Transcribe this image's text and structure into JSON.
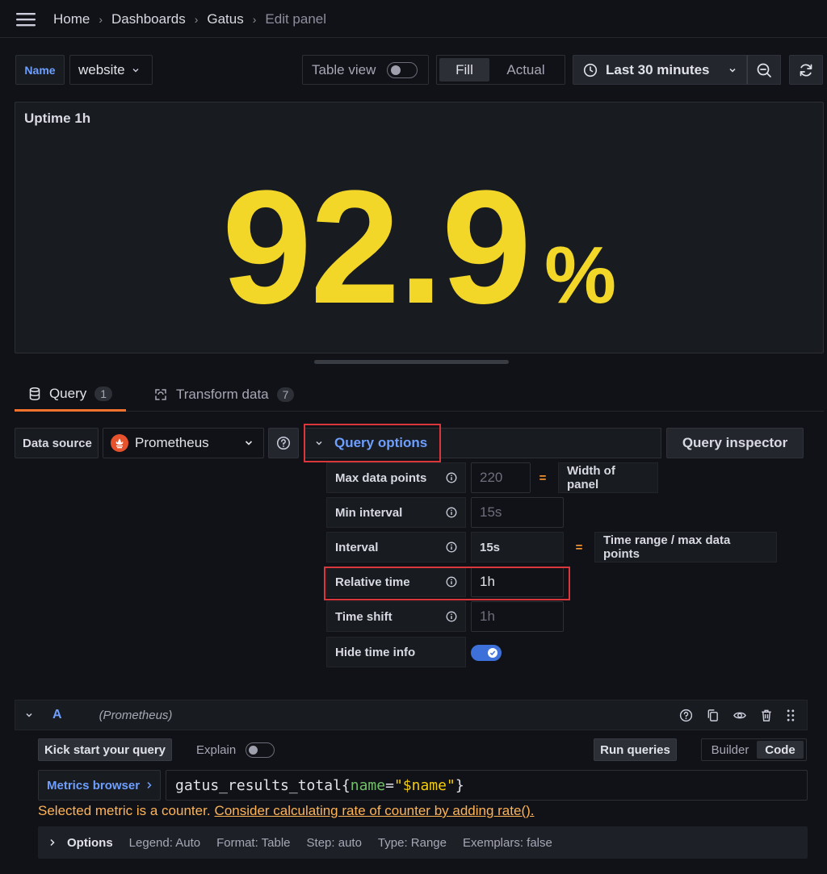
{
  "breadcrumb": [
    "Home",
    "Dashboards",
    "Gatus",
    "Edit panel"
  ],
  "variable": {
    "label": "Name",
    "value": "website"
  },
  "toolbar": {
    "table_view_label": "Table view",
    "table_view_on": false,
    "fill_label": "Fill",
    "actual_label": "Actual",
    "time_range": "Last 30 minutes"
  },
  "panel": {
    "title": "Uptime 1h",
    "value": "92.9",
    "unit": "%",
    "value_color": "#f2d729"
  },
  "tabs": [
    {
      "label": "Query",
      "count": "1",
      "active": true
    },
    {
      "label": "Transform data",
      "count": "7",
      "active": false
    }
  ],
  "datasource": {
    "label": "Data source",
    "name": "Prometheus"
  },
  "query_options": {
    "toggle_label": "Query options",
    "inspector_label": "Query inspector",
    "max_data_points": {
      "label": "Max data points",
      "placeholder": "220",
      "note": "Width of panel"
    },
    "min_interval": {
      "label": "Min interval",
      "placeholder": "15s"
    },
    "interval": {
      "label": "Interval",
      "value": "15s",
      "note": "Time range / max data points"
    },
    "relative_time": {
      "label": "Relative time",
      "value": "1h"
    },
    "time_shift": {
      "label": "Time shift",
      "placeholder": "1h"
    },
    "hide_time_info": {
      "label": "Hide time info",
      "on": true
    },
    "equals": "="
  },
  "query_a": {
    "ref": "A",
    "datasource": "(Prometheus)",
    "kick_start_label": "Kick start your query",
    "explain_label": "Explain",
    "run_label": "Run queries",
    "builder_label": "Builder",
    "code_label": "Code",
    "metrics_browser_label": "Metrics browser",
    "expr_metric": "gatus_results_total{",
    "expr_label": "name",
    "expr_eq": "=",
    "expr_value": "\"$name\"",
    "expr_close": "}",
    "warning_text": "Selected metric is a counter.",
    "warning_link": "Consider calculating rate of counter by adding rate().",
    "options": {
      "title": "Options",
      "legend": "Legend: Auto",
      "format": "Format: Table",
      "step": "Step: auto",
      "type": "Type: Range",
      "exemplars": "Exemplars: false"
    }
  },
  "colors": {
    "accent_blue": "#6e9fff",
    "annotation_red": "#d9373b",
    "tab_underline": "#f5722d",
    "warning": "#ffb357"
  }
}
